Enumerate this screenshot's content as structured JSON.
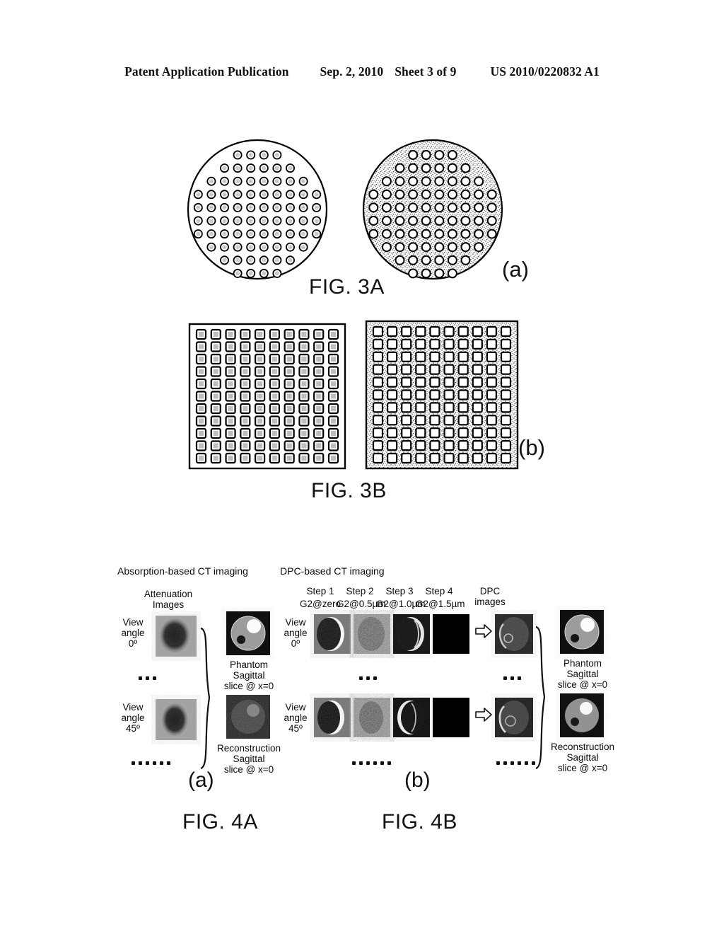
{
  "header": {
    "publication": "Patent Application Publication",
    "date": "Sep. 2, 2010",
    "sheet": "Sheet 3 of 9",
    "number": "US 2010/0220832 A1"
  },
  "figures": {
    "fig3a": {
      "caption": "FIG. 3A",
      "sublabel": "(a)",
      "shape": "circle",
      "rows": [
        4,
        6,
        8,
        10,
        10,
        10,
        10,
        8,
        6,
        4
      ]
    },
    "fig3b": {
      "caption": "FIG. 3B",
      "sublabel": "(b)",
      "shape": "square",
      "cols": 10,
      "rows": 11
    },
    "fig4a": {
      "caption": "FIG. 4A",
      "sublabel": "(a)"
    },
    "fig4b": {
      "caption": "FIG. 4B",
      "sublabel": "(b)"
    }
  },
  "fig4a": {
    "title": "Absorption-based CT imaging",
    "column_header": "Attenuation\nImages",
    "rows": [
      {
        "view_label": "View\nangle\n0º"
      },
      {
        "view_label": "View\nangle\n45º"
      }
    ],
    "results": [
      {
        "label": "Phantom\nSagittal\nslice @ x=0"
      },
      {
        "label": "Reconstruction\nSagittal\nslice @ x=0"
      }
    ],
    "ellipsis_short": "• • •",
    "ellipsis_long": "• • • • • •"
  },
  "fig4b": {
    "title": "DPC-based CT imaging",
    "steps": [
      {
        "step": "Step 1",
        "setting": "G2@zero"
      },
      {
        "step": "Step 2",
        "setting": "G2@0.5µm"
      },
      {
        "step": "Step 3",
        "setting": "G2@1.0µm"
      },
      {
        "step": "Step 4",
        "setting": "G2@1.5µm"
      }
    ],
    "dpc_header": "DPC\nimages",
    "rows": [
      {
        "view_label": "View\nangle\n0º"
      },
      {
        "view_label": "View\nangle\n45º"
      }
    ],
    "results": [
      {
        "label": "Phantom\nSagittal\nslice @ x=0"
      },
      {
        "label": "Reconstruction\nSagittal\nslice @ x=0"
      }
    ],
    "ellipsis_short": "• • •",
    "ellipsis_long": "• • • • • •"
  },
  "colors": {
    "ink": "#000000",
    "stipple_gray": "#b9b9b9",
    "phantom_bg": "#050505",
    "phantom_body": "#9a9a9a",
    "phantom_hi": "#ffffff",
    "phantom_lo": "#111111"
  }
}
